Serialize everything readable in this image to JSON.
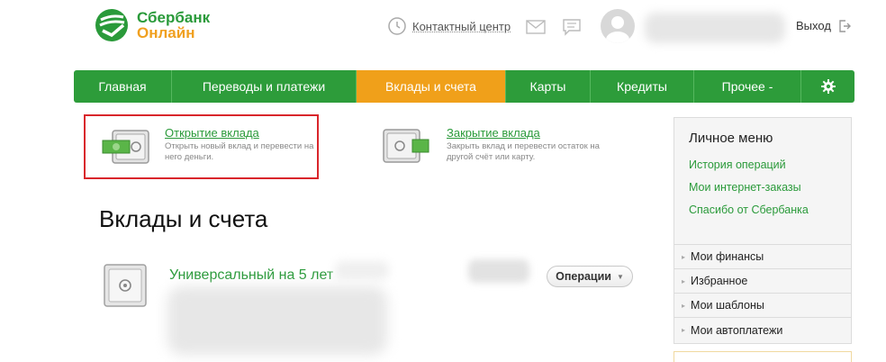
{
  "header": {
    "logo_line1": "Сбербанк",
    "logo_line2": "Онлайн",
    "contact_label": "Контактный центр",
    "logout_label": "Выход"
  },
  "nav": {
    "items": [
      {
        "label": "Главная",
        "active": false
      },
      {
        "label": "Переводы и платежи",
        "active": false
      },
      {
        "label": "Вклады и счета",
        "active": true
      },
      {
        "label": "Карты",
        "active": false
      },
      {
        "label": "Кредиты",
        "active": false
      },
      {
        "label": "Прочее -",
        "active": false
      }
    ],
    "settings_icon": "gear-icon"
  },
  "actions": {
    "open": {
      "title": "Открытие вклада",
      "description": "Открыть новый вклад и перевести на него деньги."
    },
    "close": {
      "title": "Закрытие вклада",
      "description": "Закрыть вклад и перевести остаток на другой счёт или карту."
    }
  },
  "main": {
    "title": "Вклады и счета",
    "deposit": {
      "name": "Универсальный на 5 лет",
      "operations_label": "Операции"
    }
  },
  "sidebar": {
    "title": "Личное меню",
    "links": [
      "История операций",
      "Мои интернет-заказы",
      "Спасибо от Сбербанка"
    ],
    "sections": [
      "Мои финансы",
      "Избранное",
      "Мои шаблоны",
      "Мои автоплатежи"
    ]
  },
  "colors": {
    "brand_green": "#2d9c3a",
    "active_orange": "#f0a01a",
    "highlight_red": "#d9262b"
  }
}
